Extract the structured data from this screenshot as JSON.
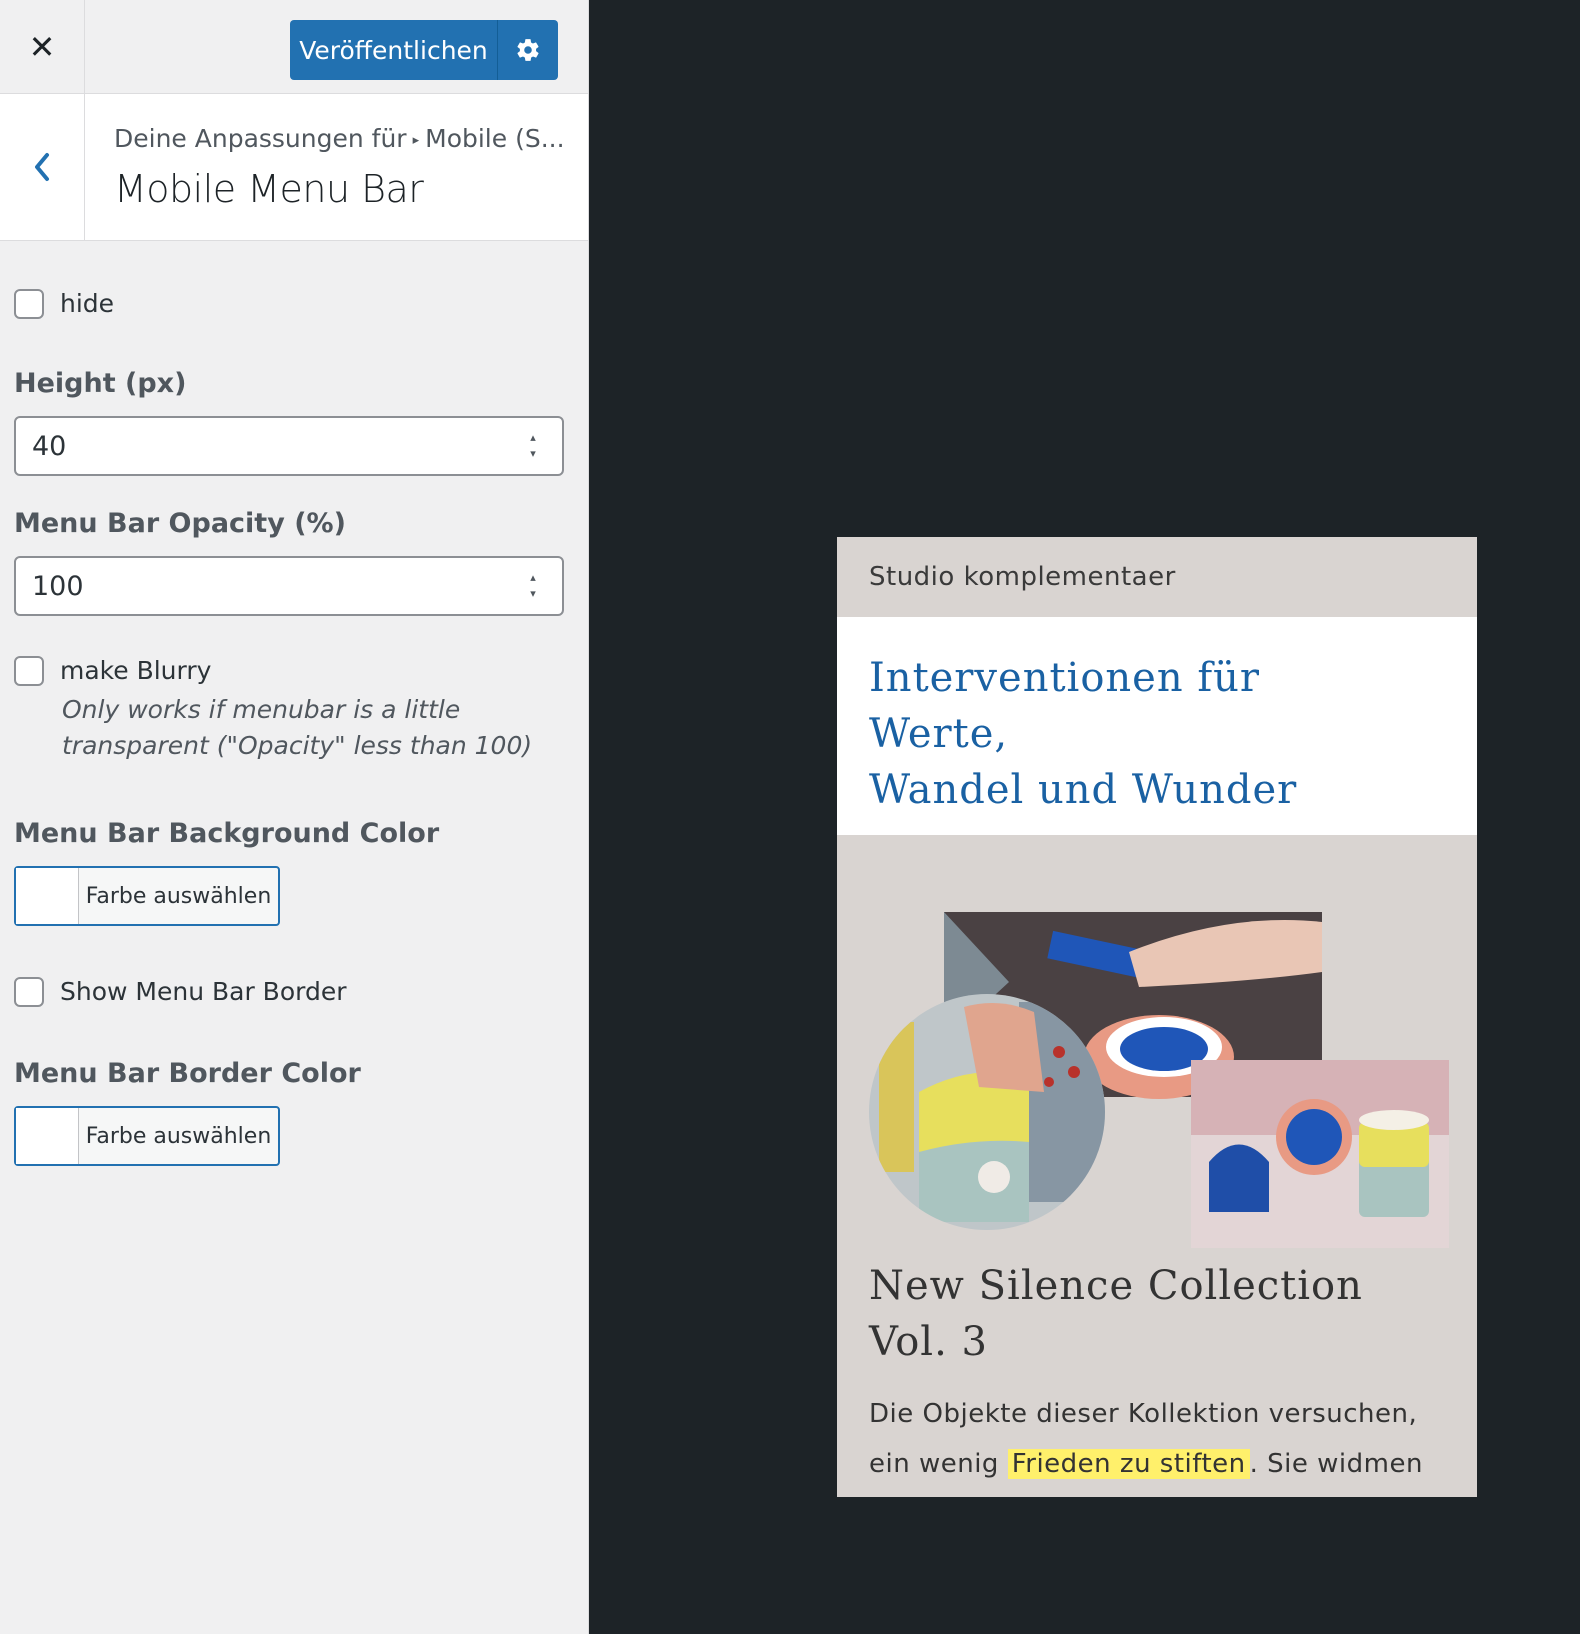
{
  "topbar": {
    "close_icon": "close-icon",
    "publish_label": "Veröffentlichen",
    "settings_icon": "gear-icon"
  },
  "section": {
    "breadcrumb_parent": "Deine Anpassungen für",
    "breadcrumb_child": "Mobile (S...",
    "title": "Mobile Menu Bar"
  },
  "controls": {
    "hide_label": "hide",
    "height_label": "Height (px)",
    "height_value": "40",
    "opacity_label": "Menu Bar Opacity (%)",
    "opacity_value": "100",
    "blurry_label": "make Blurry",
    "blurry_desc_1": "Only works if menubar is a little",
    "blurry_desc_2": "transparent (\"Opacity\" less than 100)",
    "bg_color_label": "Menu Bar Background Color",
    "bg_color_button": "Farbe auswählen",
    "border_label": "Show Menu Bar Border",
    "border_color_label": "Menu Bar Border Color",
    "border_color_button": "Farbe auswählen"
  },
  "preview": {
    "site_title": "Studio komplementaer",
    "hero_line_1": "Interventionen für",
    "hero_line_2": "Werte,",
    "hero_line_3": "Wandel und Wunder",
    "post_title_1": "New Silence Collection",
    "post_title_2": "Vol. 3",
    "excerpt_line_1": "Die Objekte dieser Kollektion versuchen,",
    "excerpt_pre": "ein wenig ",
    "excerpt_highlight": "Frieden zu stiften",
    "excerpt_post": ". Sie widmen"
  },
  "colors": {
    "accent": "#2271b1",
    "preview_bg": "#1d2327",
    "hero_text": "#1a61a3",
    "highlight": "#fff06b"
  }
}
